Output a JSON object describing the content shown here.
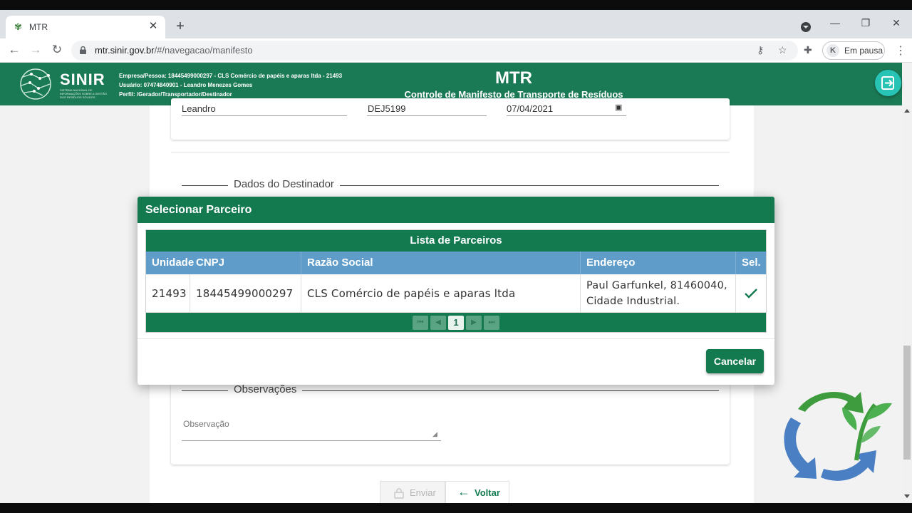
{
  "browser": {
    "tab_title": "MTR",
    "url_host": "mtr.sinir.gov.br",
    "url_path": "/#/navegacao/manifesto",
    "profile_status": "Em pausa"
  },
  "header": {
    "logo_text": "SINIR",
    "logo_subtitle": "SISTEMA NACIONAL DE INFORMAÇÕES SOBRE A GESTÃO DOS RESÍDUOS SÓLIDOS",
    "company_line": "Empresa/Pessoa: 18445499000297 - CLS Comércio de papéis e aparas ltda - 21493",
    "user_line": "Usuário: 07474840901 - Leandro Menezes Gomes",
    "profile_line": "Perfil: /Gerador/Transportador/Destinador",
    "app_title": "MTR",
    "app_subtitle": "Controle de Manifesto de Transporte de Resíduos"
  },
  "form": {
    "driver_name": "Leandro",
    "plate": "DEJ5199",
    "date": "07/04/2021",
    "section_destinador": "Dados do Destinador",
    "section_observacoes": "Observações",
    "observacao_placeholder": "Observação",
    "enviar_label": "Enviar",
    "voltar_label": "Voltar"
  },
  "modal": {
    "title": "Selecionar Parceiro",
    "list_caption": "Lista de Parceiros",
    "columns": [
      "Unidade",
      "CNPJ",
      "Razão Social",
      "Endereço",
      "Sel."
    ],
    "rows": [
      {
        "unidade": "21493",
        "cnpj": "18445499000297",
        "razao_social": "CLS Comércio de papéis e aparas ltda",
        "endereco_line1": "Paul Garfunkel, 81460040,",
        "endereco_line2": "Cidade Industrial."
      }
    ],
    "pager_page": "1",
    "cancel_label": "Cancelar"
  },
  "colors": {
    "brand_green": "#137a50",
    "table_header_blue": "#5f9cc9",
    "header_green": "#1b7a56",
    "logout_teal": "#27c4b5"
  }
}
